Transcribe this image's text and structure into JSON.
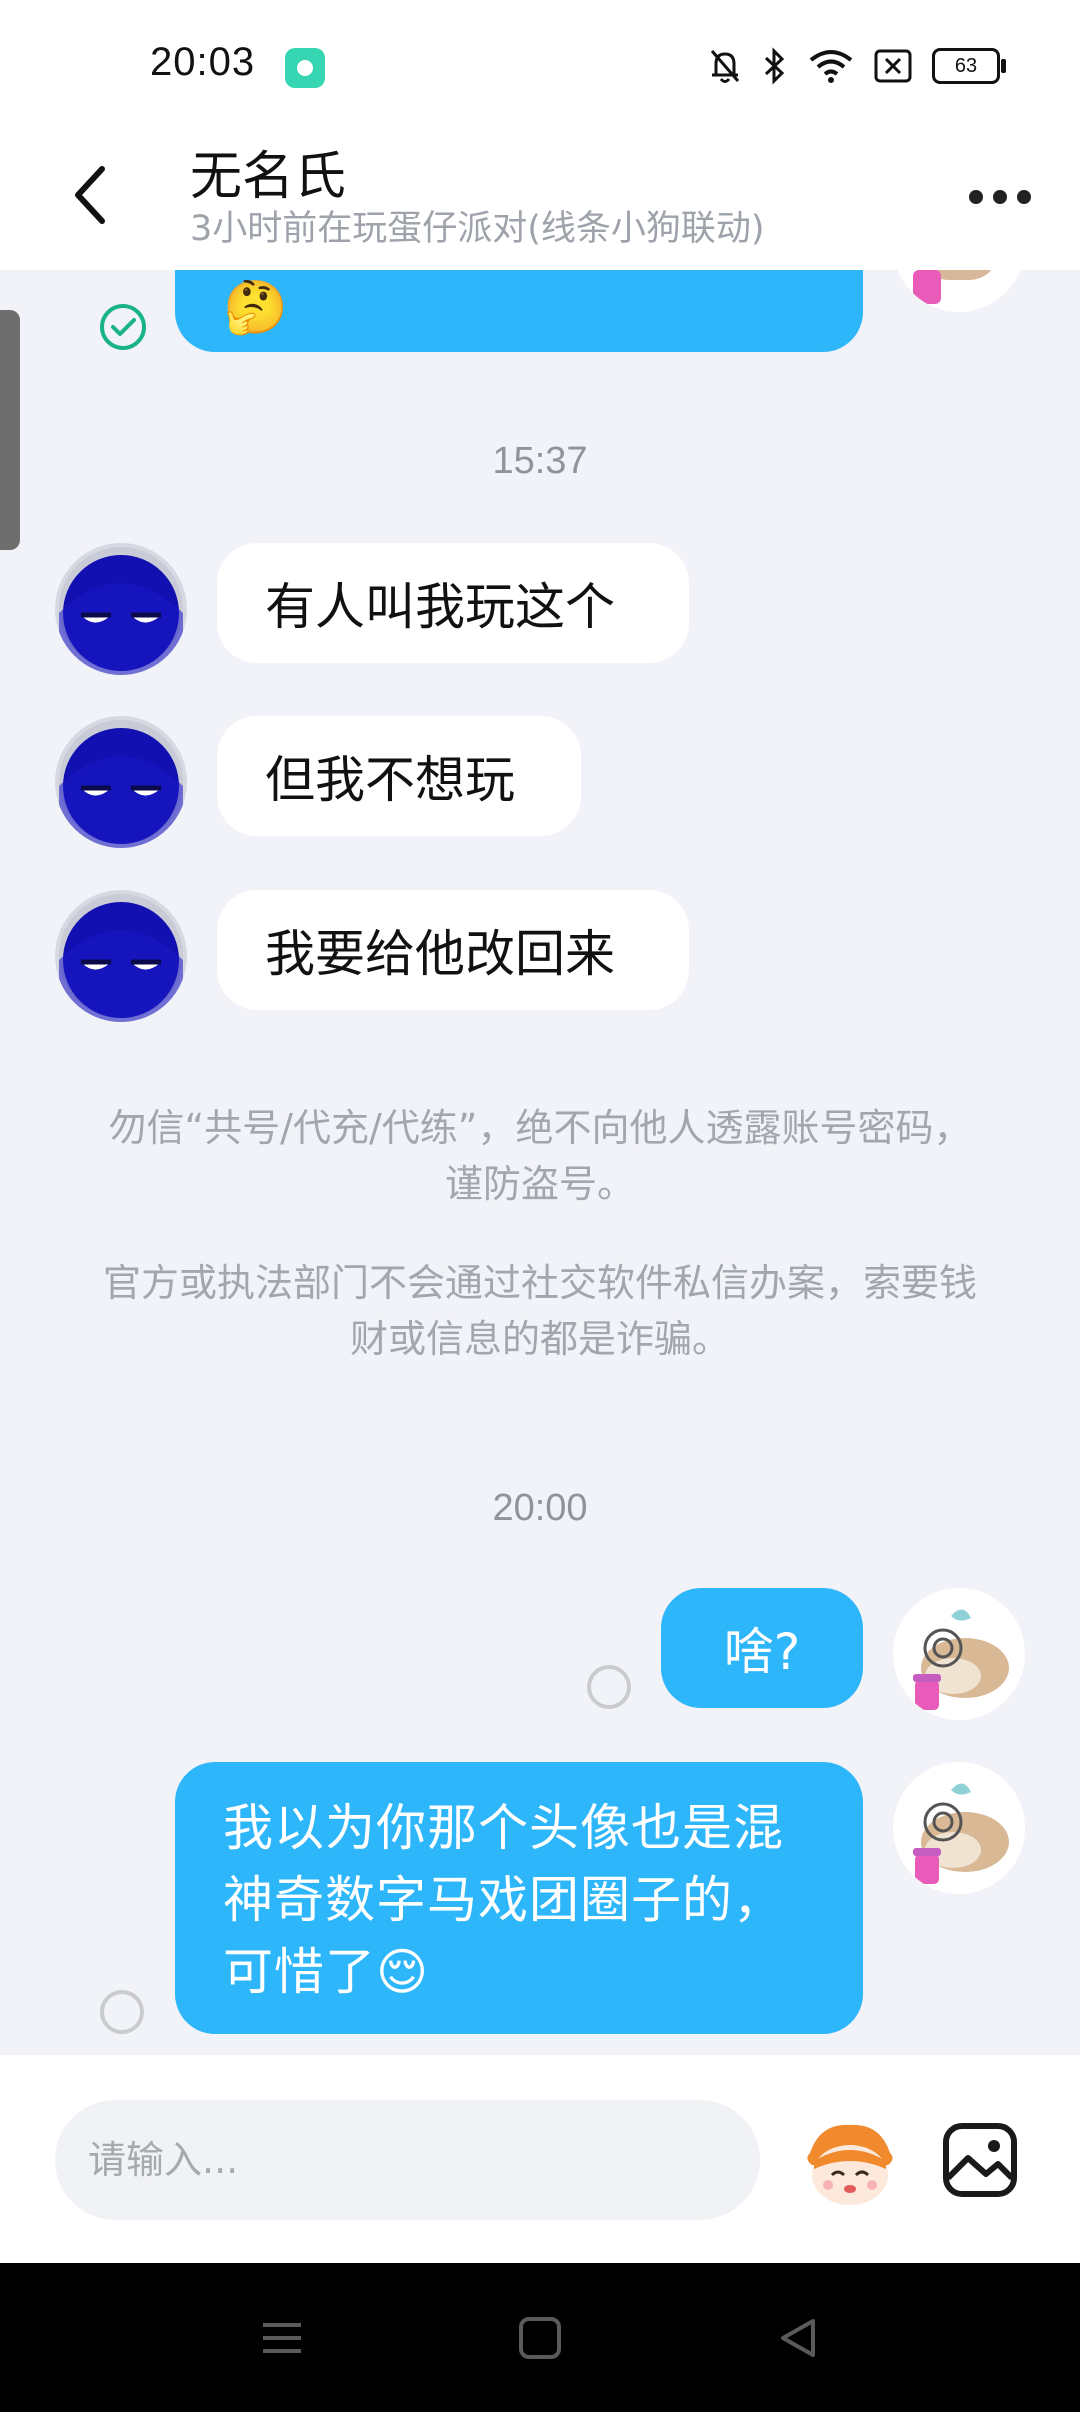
{
  "status_bar": {
    "time": "20:03",
    "battery": "63"
  },
  "header": {
    "name": "无名氏",
    "status": "3小时前在玩蛋仔派对(线条小狗联动)"
  },
  "chat": {
    "top_partial_emoji": "🤔",
    "time_1": "15:37",
    "msg_1": "有人叫我玩这个",
    "msg_2": "但我不想玩",
    "msg_3": "我要给他改回来",
    "notice_1": "勿信“共号/代充/代练”，绝不向他人透露账号密码，谨防盗号。",
    "notice_2": "官方或执法部门不会通过社交软件私信办案，索要钱财或信息的都是诈骗。",
    "time_2": "20:00",
    "msg_4": "啥?",
    "msg_5": "我以为你那个头像也是混神奇数字马戏团圈子的，可惜了😌"
  },
  "input": {
    "placeholder": "请输入..."
  },
  "colors": {
    "bubble_blue": "#2eb6fa",
    "read_green": "#19b38a",
    "background": "#f2f3f8"
  },
  "icons": {
    "back": "chevron-left-icon",
    "more": "more-horizontal-icon",
    "sticker": "sticker-face-icon",
    "image": "image-icon"
  }
}
